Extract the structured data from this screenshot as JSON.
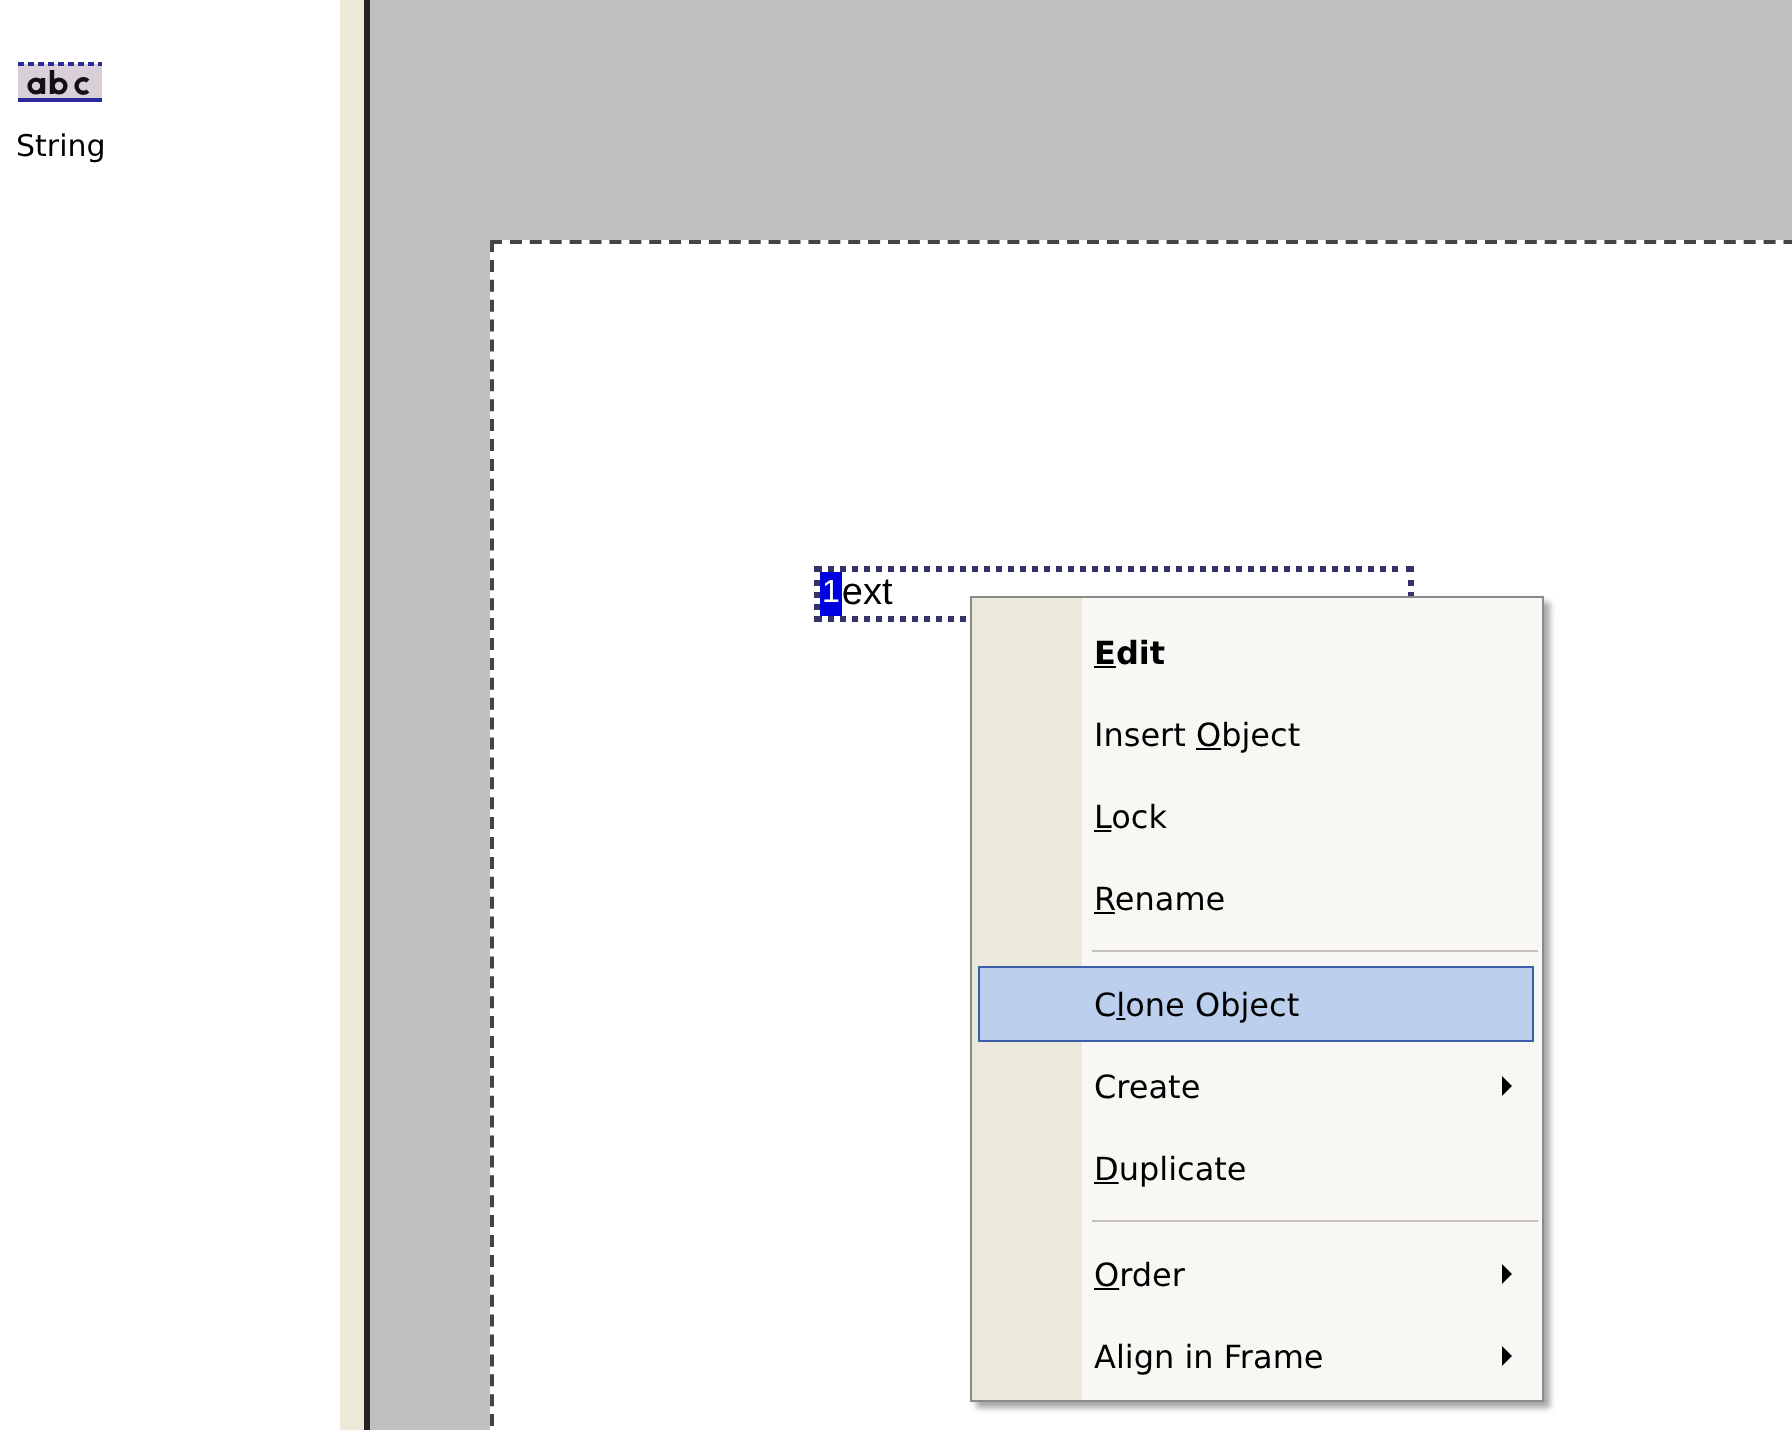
{
  "toolbox": {
    "items": [
      {
        "label": "String",
        "selected": false
      }
    ]
  },
  "canvas": {
    "text_object": {
      "selected_text": "1",
      "text": "ext"
    }
  },
  "context_menu": {
    "items": [
      {
        "kind": "command",
        "parts": [
          {
            "text": "E",
            "underlined": true
          },
          {
            "text": "dit",
            "underlined": false
          }
        ],
        "default": true,
        "selected": false
      },
      {
        "kind": "command",
        "parts": [
          {
            "text": "Insert ",
            "underlined": false
          },
          {
            "text": "O",
            "underlined": true
          },
          {
            "text": "bject",
            "underlined": false
          }
        ],
        "default": false,
        "selected": false
      },
      {
        "kind": "command",
        "parts": [
          {
            "text": "L",
            "underlined": true
          },
          {
            "text": "ock",
            "underlined": false
          }
        ],
        "default": false,
        "selected": false
      },
      {
        "kind": "command",
        "parts": [
          {
            "text": "R",
            "underlined": true
          },
          {
            "text": "ename",
            "underlined": false
          }
        ],
        "default": false,
        "selected": false
      },
      {
        "kind": "separator"
      },
      {
        "kind": "command",
        "parts": [
          {
            "text": "C",
            "underlined": false
          },
          {
            "text": "l",
            "underlined": true
          },
          {
            "text": "one Object",
            "underlined": false
          }
        ],
        "default": false,
        "selected": true
      },
      {
        "kind": "submenu",
        "parts": [
          {
            "text": "Create",
            "underlined": false
          }
        ],
        "default": false,
        "selected": false
      },
      {
        "kind": "command",
        "parts": [
          {
            "text": "D",
            "underlined": true
          },
          {
            "text": "uplicate",
            "underlined": false
          }
        ],
        "default": false,
        "selected": false
      },
      {
        "kind": "separator"
      },
      {
        "kind": "submenu",
        "parts": [
          {
            "text": "O",
            "underlined": true
          },
          {
            "text": "rder",
            "underlined": false
          }
        ],
        "default": false,
        "selected": false
      },
      {
        "kind": "submenu",
        "parts": [
          {
            "text": "Align in Frame",
            "underlined": false
          }
        ],
        "default": false,
        "selected": false
      }
    ]
  }
}
